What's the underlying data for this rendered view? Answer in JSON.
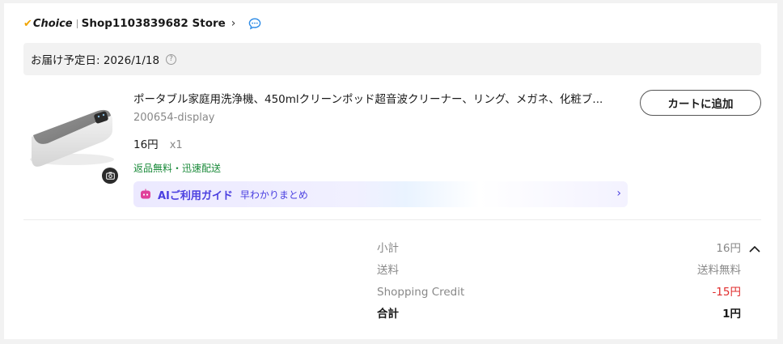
{
  "store": {
    "badge_label": "Choice",
    "name": "Shop1103839682 Store"
  },
  "delivery": {
    "label": "お届け予定日: 2026/1/18"
  },
  "product": {
    "title": "ポータブル家庭用洗浄機、450mlクリーンポッド超音波クリーナー、リング、メガネ、化粧ブ...",
    "sku": "200654-display",
    "price": "16円",
    "quantity": "x1",
    "shipping_note": "返品無料・迅速配送"
  },
  "ai_guide": {
    "title": "AIご利用ガイド",
    "subtitle": "早わかりまとめ"
  },
  "actions": {
    "add_to_cart": "カートに追加"
  },
  "summary": {
    "rows": [
      {
        "label": "小計",
        "value": "16円"
      },
      {
        "label": "送料",
        "value": "送料無料"
      },
      {
        "label": "Shopping Credit",
        "value": "-15円"
      },
      {
        "label": "合計",
        "value": "1円"
      }
    ]
  },
  "colors": {
    "choice_check": "#f0a400",
    "ai_accent": "#4a3fe0",
    "shipping_green": "#1a8a3a",
    "credit_red": "#e02b2b"
  }
}
